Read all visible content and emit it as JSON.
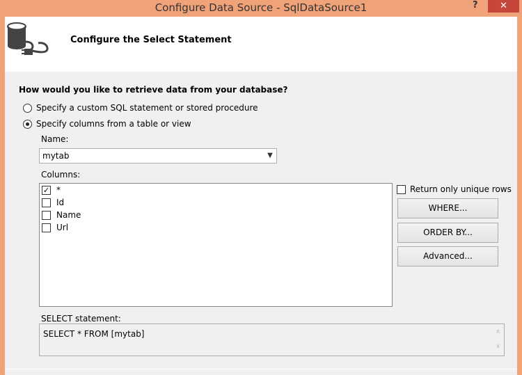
{
  "window": {
    "title": "Configure Data Source - SqlDataSource1",
    "help_label": "?",
    "close_label": "✕"
  },
  "header": {
    "heading": "Configure the Select Statement",
    "icon": "database-plug-icon"
  },
  "form": {
    "question": "How would you like to retrieve data from your database?",
    "options": [
      {
        "label": "Specify a custom SQL statement or stored procedure",
        "selected": false
      },
      {
        "label": "Specify columns from a table or view",
        "selected": true
      }
    ],
    "name_label": "Name:",
    "name_value": "mytab",
    "columns_label": "Columns:",
    "columns": [
      {
        "label": "*",
        "checked": true,
        "mark": "✓"
      },
      {
        "label": "Id",
        "checked": false,
        "mark": ""
      },
      {
        "label": "Name",
        "checked": false,
        "mark": ""
      },
      {
        "label": "Url",
        "checked": false,
        "mark": ""
      }
    ],
    "unique_rows_label": "Return only unique rows",
    "unique_rows_checked": false,
    "where_label": "WHERE...",
    "order_by_label": "ORDER BY...",
    "advanced_label": "Advanced...",
    "select_statement_label": "SELECT statement:",
    "select_statement": "SELECT * FROM [mytab]"
  }
}
